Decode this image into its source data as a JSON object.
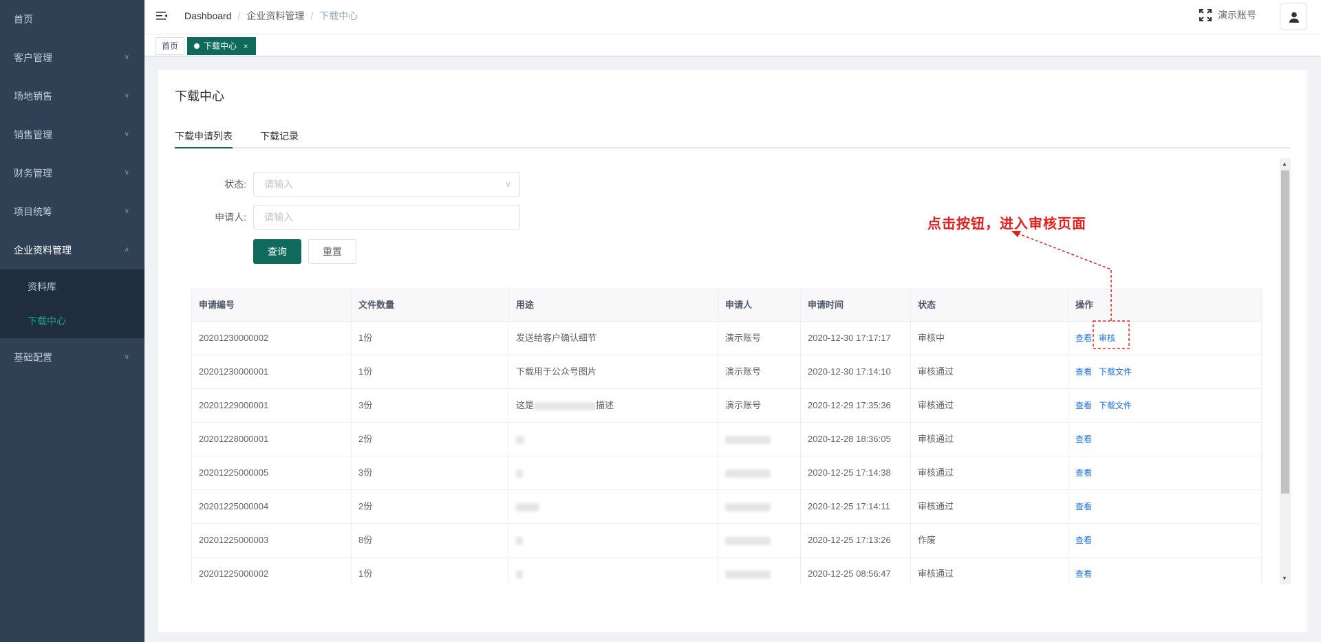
{
  "sidebar": {
    "items": [
      {
        "label": "首页"
      },
      {
        "label": "客户管理"
      },
      {
        "label": "场地销售"
      },
      {
        "label": "销售管理"
      },
      {
        "label": "财务管理"
      },
      {
        "label": "项目统筹"
      },
      {
        "label": "企业资料管理"
      },
      {
        "label": "基础配置"
      }
    ],
    "submenu": [
      {
        "label": "资料库"
      },
      {
        "label": "下载中心"
      }
    ]
  },
  "navbar": {
    "breadcrumb": [
      "Dashboard",
      "企业资料管理",
      "下载中心"
    ],
    "account_name": "演示账号"
  },
  "tags": [
    {
      "label": "首页"
    },
    {
      "label": "下载中心",
      "close": "×"
    }
  ],
  "page": {
    "title": "下载中心",
    "tabs": [
      "下载申请列表",
      "下载记录"
    ]
  },
  "form": {
    "status_label": "状态:",
    "status_placeholder": "请输入",
    "applicant_label": "申请人:",
    "applicant_placeholder": "请输入",
    "search_button": "查询",
    "reset_button": "重置"
  },
  "table": {
    "headers": [
      "申请编号",
      "文件数量",
      "用途",
      "申请人",
      "申请时间",
      "状态",
      "操作"
    ],
    "rows": [
      {
        "id": "20201230000002",
        "count": "1份",
        "purpose": "发送给客户确认细节",
        "applicant": "演示账号",
        "time": "2020-12-30 17:17:17",
        "status": "审核中",
        "ops": [
          "查看",
          "审核"
        ]
      },
      {
        "id": "20201230000001",
        "count": "1份",
        "purpose": "下载用于公众号图片",
        "applicant": "演示账号",
        "time": "2020-12-30 17:14:10",
        "status": "审核通过",
        "ops": [
          "查看",
          "下载文件"
        ]
      },
      {
        "id": "20201229000001",
        "count": "3份",
        "purpose_prefix": "这是",
        "purpose_suffix": "描述",
        "applicant": "演示账号",
        "time": "2020-12-29 17:35:36",
        "status": "审核通过",
        "ops": [
          "查看",
          "下载文件"
        ]
      },
      {
        "id": "20201228000001",
        "count": "2份",
        "time": "2020-12-28 18:36:05",
        "status": "审核通过",
        "ops": [
          "查看"
        ]
      },
      {
        "id": "20201225000005",
        "count": "3份",
        "time": "2020-12-25 17:14:38",
        "status": "审核通过",
        "ops": [
          "查看"
        ]
      },
      {
        "id": "20201225000004",
        "count": "2份",
        "time": "2020-12-25 17:14:11",
        "status": "审核通过",
        "ops": [
          "查看"
        ]
      },
      {
        "id": "20201225000003",
        "count": "8份",
        "time": "2020-12-25 17:13:26",
        "status": "作废",
        "ops": [
          "查看"
        ]
      },
      {
        "id": "20201225000002",
        "count": "1份",
        "time": "2020-12-25 08:56:47",
        "status": "审核通过",
        "ops": [
          "查看"
        ]
      }
    ]
  },
  "annotation": {
    "text": "点击按钮，进入审核页面",
    "color": "#e02020"
  },
  "colors": {
    "sidebar_bg": "#304156",
    "primary": "#0f6a5b",
    "link": "#1e6fd9"
  }
}
